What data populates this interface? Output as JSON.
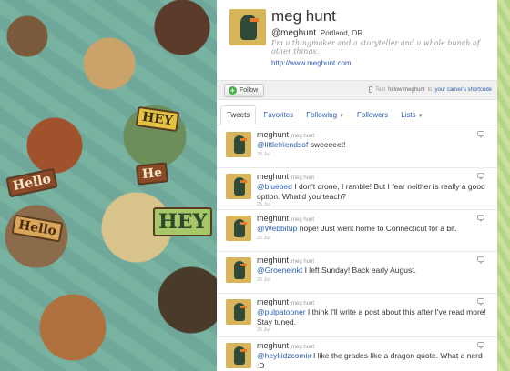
{
  "background": {
    "signs": [
      "Hello",
      "HEY",
      "HEY",
      "He",
      "Hello"
    ]
  },
  "profile": {
    "name": "meg hunt",
    "handle": "@meghunt",
    "location": "Portland, OR",
    "bio": "I'm a thingmaker and a storyteller and a whole bunch of other things.",
    "url": "http://www.meghunt.com"
  },
  "follow_bar": {
    "follow_label": "Follow",
    "sms_prefix": "Text",
    "sms_bold": "follow meghunt",
    "sms_middle": "to",
    "sms_link": "your carrier's shortcode"
  },
  "tabs": [
    {
      "label": "Tweets",
      "active": true
    },
    {
      "label": "Favorites"
    },
    {
      "label": "Following"
    },
    {
      "label": "Followers"
    },
    {
      "label": "Lists"
    }
  ],
  "tweets": [
    {
      "user": "meghunt",
      "realname": "meg hunt",
      "mention": "@littlefriendsof",
      "text": " sweeeeet!",
      "time": "25 Jul"
    },
    {
      "user": "meghunt",
      "realname": "meg hunt",
      "mention": "@bluebed",
      "text": " I don't drone, I ramble! But I fear neither is really a good option. What'd you teach?",
      "time": "25 Jul"
    },
    {
      "user": "meghunt",
      "realname": "meg hunt",
      "mention": "@Webbitup",
      "text": " nope! Just went home to Connecticut for a bit.",
      "time": "25 Jul"
    },
    {
      "user": "meghunt",
      "realname": "meg hunt",
      "mention": "@Groeneinkt",
      "text": " I left Sunday! Back early August.",
      "time": "25 Jul"
    },
    {
      "user": "meghunt",
      "realname": "meg hunt",
      "mention": "@pulpatooner",
      "text": " I think I'll write a post about this after I've read more! Stay tuned.",
      "time": "25 Jul"
    },
    {
      "user": "meghunt",
      "realname": "meg hunt",
      "mention": "@heykidzcomix",
      "text": " I like the grades like a dragon quote. What a nerd :D",
      "time": ""
    }
  ]
}
